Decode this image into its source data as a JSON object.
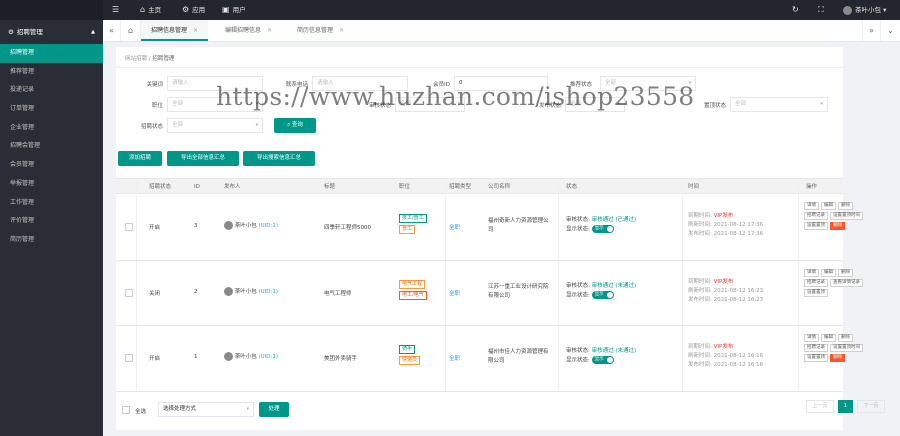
{
  "topbar": {
    "menu_icon": "menu-icon",
    "home": "主页",
    "apps": "应用",
    "user": "用户",
    "username": "茶叶小包 ▾"
  },
  "sidebar": {
    "group": "招聘管理",
    "items": [
      "招聘管理",
      "推荐管理",
      "投递记录",
      "订单管理",
      "企业管理",
      "招聘会管理",
      "会员管理",
      "举报管理",
      "工作管理",
      "评价管理",
      "简历管理"
    ]
  },
  "tabs": [
    "招聘信息管理",
    "编辑招聘信息",
    "简历信息管理"
  ],
  "breadcrumb": {
    "parent": "网站招聘",
    "sep": "/",
    "current": "招聘管理"
  },
  "filters": {
    "keyword": {
      "label": "关键词",
      "placeholder": "请输入"
    },
    "phone": {
      "label": "联系电话",
      "placeholder": "请输入"
    },
    "id": {
      "label": "会员ID",
      "value": "0"
    },
    "city": {
      "label": "推荐状态",
      "placeholder": "全部"
    },
    "position": {
      "label": "职位",
      "placeholder": "全部"
    },
    "audit": {
      "label": "审核状态",
      "placeholder": "全部"
    },
    "publish": {
      "label": "发布状态",
      "placeholder": "全部"
    },
    "display": {
      "label": "置顶状态",
      "placeholder": "全部"
    },
    "recruit": {
      "label": "招聘状态",
      "placeholder": "全部"
    },
    "search_btn": "查询"
  },
  "watermark": "https://www.huzhan.com/ishop23558",
  "actions": [
    "添加招聘",
    "导出全部信息汇总",
    "导出搜索信息汇总"
  ],
  "table": {
    "headers": [
      "招聘状态",
      "ID",
      "发布人",
      "标题",
      "职位",
      "招聘类型",
      "公司名称",
      "状态",
      "时间",
      "操作"
    ],
    "rows": [
      {
        "status": "开启",
        "id": "3",
        "user": "茶叶小包",
        "uid": "(UID:1)",
        "title": "四季轩工程师5000",
        "tags": [
          "技工/普工",
          "普工"
        ],
        "type": "全职",
        "company": "福州奇新人力资源管理公司",
        "audit_label": "审核状态:",
        "audit": "审核通过 (已通过)",
        "disp_label": "显示状态:",
        "disp": "显示",
        "vip_label": "到期时间:",
        "vip": "VIP发布",
        "t1_label": "刷新时间:",
        "t1": "2021-08-12 17:36",
        "t2_label": "发布时间:",
        "t2": "2021-08-12 17:36",
        "ops": [
          "详情",
          "编辑",
          "删除",
          "招聘记录",
          "设置置顶时间",
          "设置置顶",
          "删除"
        ]
      },
      {
        "status": "关闭",
        "id": "2",
        "user": "茶叶小包",
        "uid": "(UID:1)",
        "title": "电气工程师",
        "tags": [
          "电气工程",
          "电工/电气"
        ],
        "type": "全职",
        "company": "江苏一重工业设计研究院有限公司",
        "audit_label": "审核状态:",
        "audit": "审核通过 (未通过)",
        "disp_label": "显示状态:",
        "disp": "显示",
        "vip_label": "到期时间:",
        "vip": "VIP发布",
        "t1_label": "刷新时间:",
        "t1": "2021-08-12 16:23",
        "t2_label": "发布时间:",
        "t2": "2021-08-12 16:23",
        "ops": [
          "详情",
          "编辑",
          "删除",
          "招聘记录",
          "查看详情记录",
          "设置置顶"
        ]
      },
      {
        "status": "开启",
        "id": "1",
        "user": "茶叶小包",
        "uid": "(UID:1)",
        "title": "美团外卖骑手",
        "tags": [
          "骑手",
          "快递员"
        ],
        "type": "全职",
        "company": "福州市佳人力资源管理有限公司",
        "audit_label": "审核状态:",
        "audit": "审核通过 (未通过)",
        "disp_label": "显示状态:",
        "disp": "显示",
        "vip_label": "到期时间:",
        "vip": "VIP发布",
        "t1_label": "刷新时间:",
        "t1": "2021-08-12 16:16",
        "t2_label": "发布时间:",
        "t2": "2021-08-12 16:16",
        "ops": [
          "详情",
          "编辑",
          "删除",
          "招聘记录",
          "设置置顶时间",
          "设置置顶",
          "删除"
        ]
      }
    ]
  },
  "footer": {
    "select_all": "全选",
    "batch_placeholder": "选择处理方式",
    "batch_btn": "处理",
    "prev": "上一页",
    "page": "1",
    "next": "下一页"
  }
}
